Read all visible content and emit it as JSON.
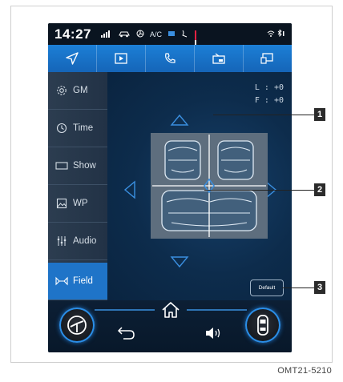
{
  "status_bar": {
    "time": "14:27",
    "ac_label": "A/C"
  },
  "nav_bar": {
    "items": [
      "navigation-icon",
      "media-icon",
      "phone-icon",
      "vehicle-settings-icon",
      "display-icon"
    ]
  },
  "sidebar": {
    "items": [
      {
        "label": "GM",
        "icon": "gear-icon"
      },
      {
        "label": "Time",
        "icon": "clock-icon"
      },
      {
        "label": "Show",
        "icon": "rectangle-icon"
      },
      {
        "label": "WP",
        "icon": "image-icon"
      },
      {
        "label": "Audio",
        "icon": "equalizer-icon"
      },
      {
        "label": "Field",
        "icon": "field-icon"
      }
    ],
    "active": "Field"
  },
  "field_panel": {
    "l_value": "L : +0",
    "f_value": "F : +0",
    "default_label": "Default"
  },
  "callouts": [
    "1",
    "2",
    "3"
  ],
  "figure_code": "OMT21-5210",
  "colors": {
    "accent": "#1f74c8",
    "nav_blue": "#1c7fd6",
    "arrow_blue": "#3a8fe0",
    "screen_bg": "#0b1e33"
  }
}
